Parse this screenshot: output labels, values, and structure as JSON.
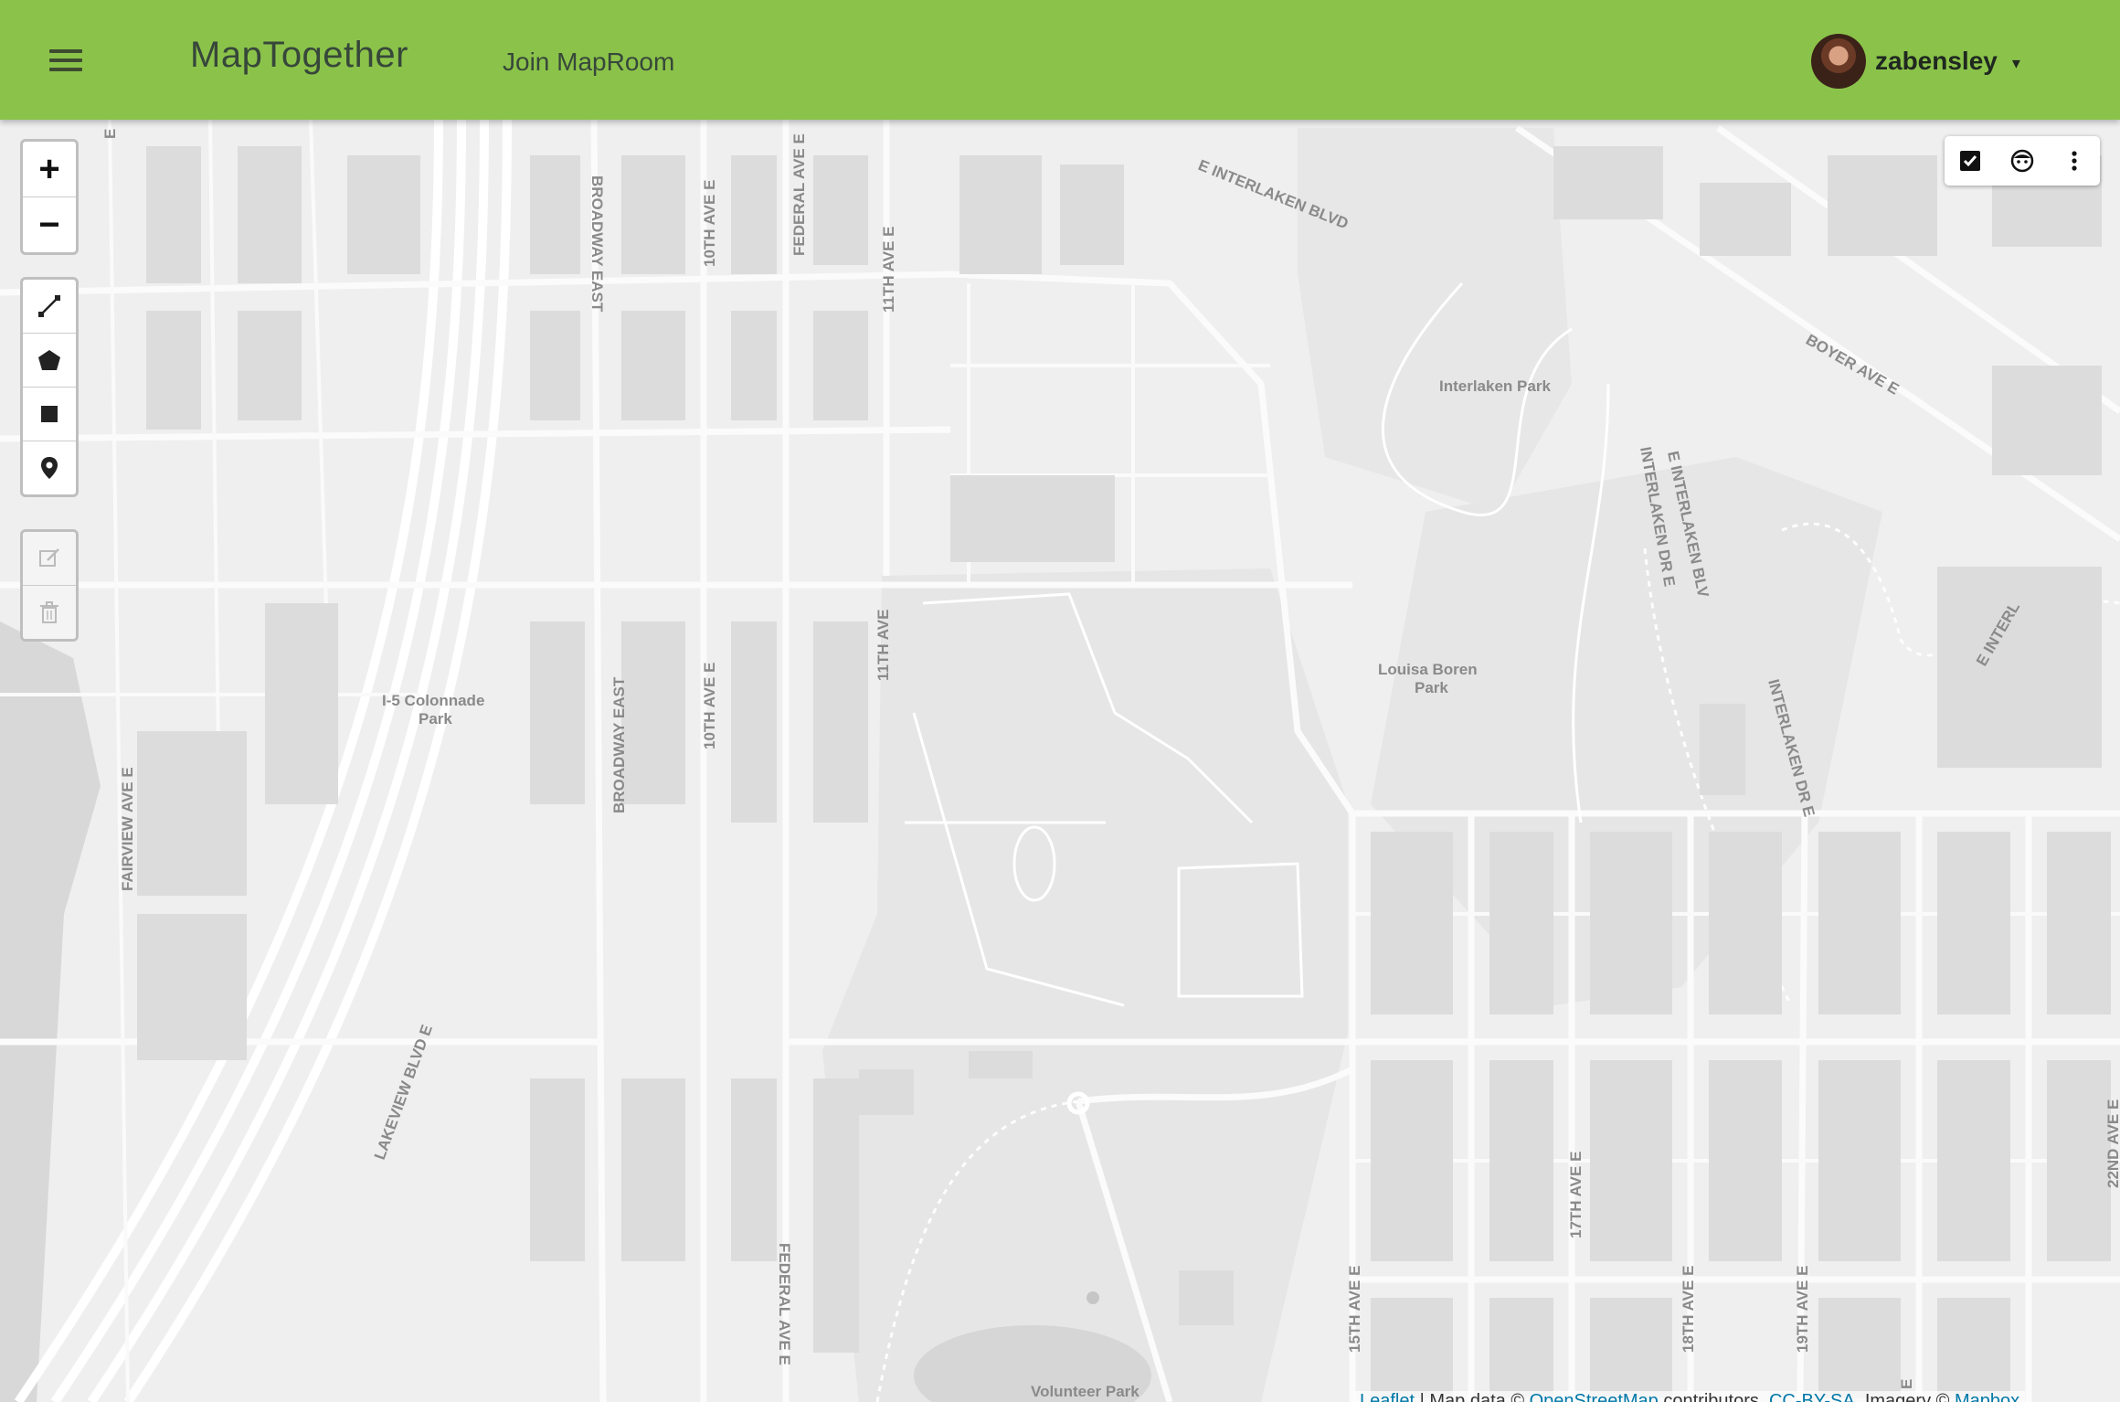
{
  "app": {
    "title": "MapTogether",
    "join_label": "Join MapRoom",
    "menu_icon": "hamburger-menu-icon",
    "brand_color": "#8bc34a"
  },
  "user": {
    "name": "zabensley",
    "caret": "▾"
  },
  "zoom": {
    "in_label": "+",
    "out_label": "−"
  },
  "draw_tools": [
    "polyline-tool",
    "polygon-tool",
    "rectangle-tool",
    "marker-tool"
  ],
  "edit_tools": [
    "edit-layers-tool",
    "delete-layers-tool"
  ],
  "layer_toolbar": [
    "checkbox-icon",
    "face-icon",
    "more-vert-icon"
  ],
  "map": {
    "labels": {
      "interlaken_blvd": "E INTERLAKEN BLVD",
      "interlaken_park": "Interlaken Park",
      "boyer_ave": "BOYER AVE E",
      "broadway_east_n": "BROADWAY EAST",
      "broadway_east_s": "BROADWAY EAST",
      "tenth_ave_e_n": "10TH AVE E",
      "tenth_ave_e_s": "10TH AVE E",
      "federal_ave_e_n": "FEDERAL AVE E",
      "federal_ave_e_s": "FEDERAL AVE E",
      "eleventh_ave_e": "11TH AVE E",
      "eleventh_ave": "11TH AVE",
      "interlaken_dr_e_1": "INTERLAKEN DR E",
      "e_interlaken_blv": "E INTERLAKEN BLV",
      "interlaken_dr_e_2": "INTERLAKEN DR E",
      "e_interl": "E INTERL",
      "louisa_boren": "Louisa Boren",
      "louisa_boren_2": "Park",
      "colonnade": "I-5 Colonnade",
      "colonnade_2": "Park",
      "fairview": "FAIRVIEW AVE E",
      "lakeview": "LAKEVIEW BLVD E",
      "fifteenth": "15TH AVE E",
      "seventeenth": "17TH AVE E",
      "eighteenth": "18TH AVE E",
      "nineteenth": "19TH AVE E",
      "twentysecond": "22ND AVE E",
      "volunteer_park": "Volunteer Park",
      "e_edge_top": "E",
      "e_bottom": "E"
    }
  },
  "attribution": {
    "leaflet": "Leaflet",
    "text": " | Map data © ",
    "osm": "OpenStreetMap",
    "text2": " contributors, ",
    "license": "CC-BY-SA",
    "text3": ", Imagery © ",
    "mapbox": "Mapbox"
  }
}
